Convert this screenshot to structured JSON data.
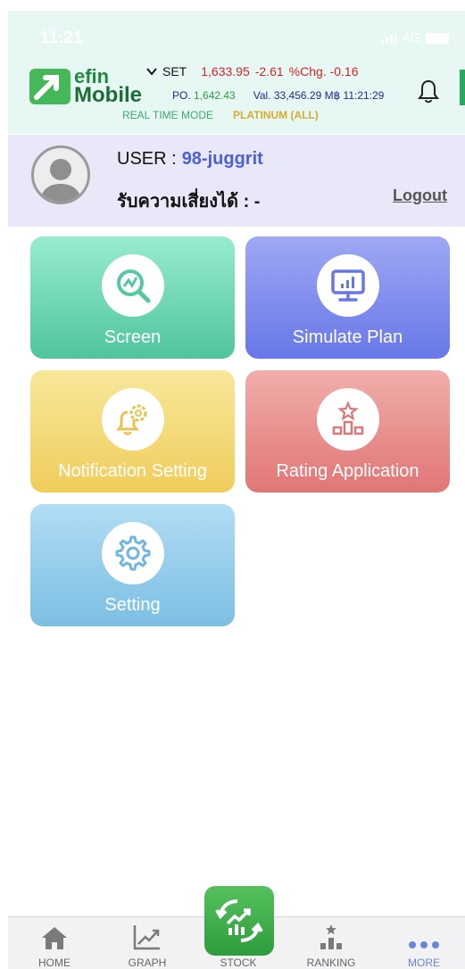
{
  "status_bar": {
    "time": "11:21",
    "network": "4G"
  },
  "header": {
    "logo_line1": "efin",
    "logo_line2": "Mobile",
    "market": "SET",
    "index_value": "1,633.95",
    "change": "-2.61",
    "pct_change": "%Chg. -0.16",
    "po_label": "PO.",
    "po_value": "1,642.43",
    "value_text": "Val. 33,456.29 M฿ 11:21:29",
    "mode": "REAL TIME MODE",
    "tier": "PLATINUM (ALL)"
  },
  "user": {
    "label": "USER :",
    "name": "98-juggrit",
    "risk_label": "รับความเสี่ยงได้ : -",
    "logout": "Logout"
  },
  "tiles": [
    {
      "label": "Screen",
      "icon": "magnifier-chart-icon"
    },
    {
      "label": "Simulate Plan",
      "icon": "monitor-chart-icon"
    },
    {
      "label": "Notification Setting",
      "icon": "bell-gear-icon"
    },
    {
      "label": "Rating Application",
      "icon": "podium-star-icon"
    },
    {
      "label": "Setting",
      "icon": "gear-icon"
    }
  ],
  "tabbar": {
    "items": [
      {
        "label": "HOME",
        "icon": "home-icon"
      },
      {
        "label": "GRAPH",
        "icon": "graph-icon"
      },
      {
        "label": "STOCK",
        "icon": "stock-exchange-icon"
      },
      {
        "label": "RANKING",
        "icon": "ranking-icon"
      },
      {
        "label": "MORE",
        "icon": "more-dots-icon"
      }
    ],
    "active": "MORE"
  },
  "colors": {
    "screen": "#4fc49d",
    "simulate": "#6877e8",
    "notification": "#f0cd5c",
    "rating": "#e07676",
    "setting": "#7cbfe3",
    "accent_blue": "#4b5fd7",
    "active_tab": "#6a86d8"
  }
}
